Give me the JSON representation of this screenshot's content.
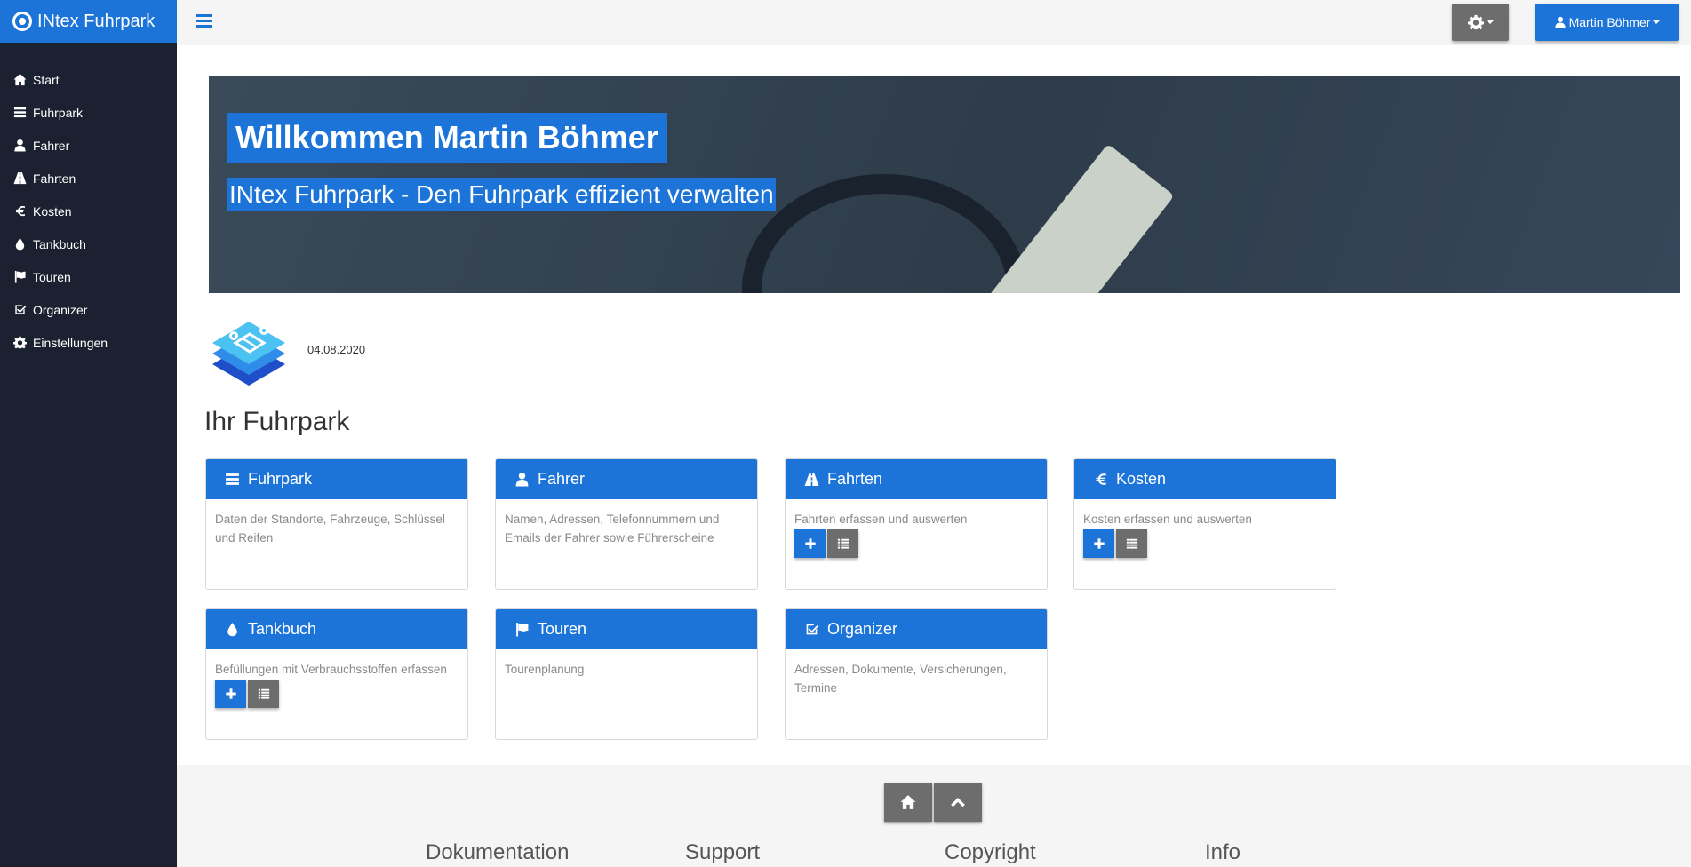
{
  "brand": {
    "name": "INtex Fuhrpark"
  },
  "sidebar": {
    "items": [
      {
        "label": "Start",
        "icon": "home-icon"
      },
      {
        "label": "Fuhrpark",
        "icon": "list-icon"
      },
      {
        "label": "Fahrer",
        "icon": "user-icon"
      },
      {
        "label": "Fahrten",
        "icon": "road-icon"
      },
      {
        "label": "Kosten",
        "icon": "euro-icon"
      },
      {
        "label": "Tankbuch",
        "icon": "drop-icon"
      },
      {
        "label": "Touren",
        "icon": "flag-icon"
      },
      {
        "label": "Organizer",
        "icon": "check-square-icon"
      },
      {
        "label": "Einstellungen",
        "icon": "gear-icon"
      }
    ]
  },
  "topbar": {
    "user_label": "Martin Böhmer"
  },
  "hero": {
    "title": "Willkommen Martin Böhmer",
    "subtitle": "INtex Fuhrpark - Den Fuhrpark effizient verwalten"
  },
  "date": "04.08.2020",
  "section_title": "Ihr Fuhrpark",
  "cards": [
    {
      "title": "Fuhrpark",
      "text": "Daten der Standorte, Fahrzeuge, Schlüssel und Reifen",
      "icon": "list-icon"
    },
    {
      "title": "Fahrer",
      "text": "Namen, Adressen, Telefonnummern und Emails der Fahrer sowie Führerscheine",
      "icon": "user-icon"
    },
    {
      "title": "Fahrten",
      "text": "Fahrten erfassen und auswerten",
      "icon": "road-icon"
    },
    {
      "title": "Kosten",
      "text": "Kosten erfassen und auswerten",
      "icon": "euro-icon"
    },
    {
      "title": "Tankbuch",
      "text": "Befüllungen mit Verbrauchsstoffen erfassen",
      "icon": "drop-icon"
    },
    {
      "title": "Touren",
      "text": "Tourenplanung",
      "icon": "flag-icon"
    },
    {
      "title": "Organizer",
      "text": "Adressen, Dokumente, Versicherungen, Termine",
      "icon": "check-square-icon"
    }
  ],
  "footer": {
    "columns": [
      "Dokumentation",
      "Support",
      "Copyright",
      "Info"
    ]
  },
  "colors": {
    "accent": "#1d74d8",
    "sidebar_bg": "#1b2130",
    "button_gray": "#6d6d6d"
  }
}
